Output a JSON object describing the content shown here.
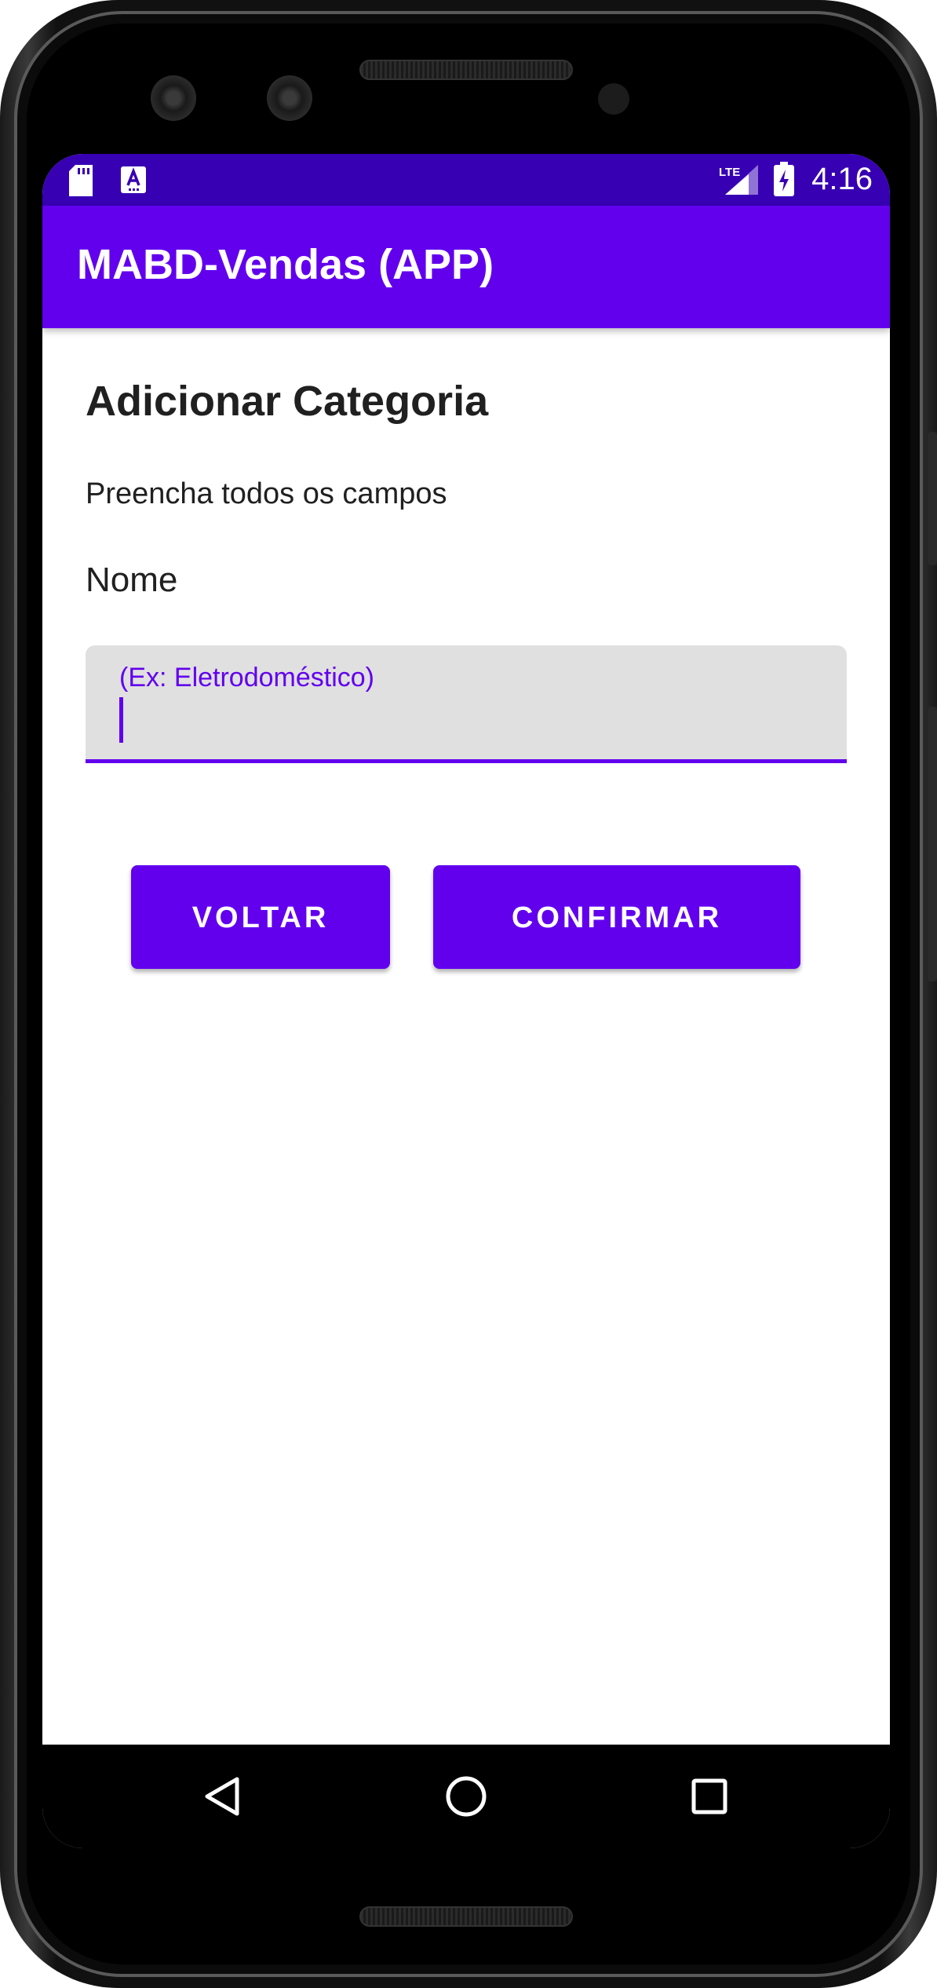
{
  "status_bar": {
    "time": "4:16",
    "network": "LTE",
    "icons": [
      "sd-card-icon",
      "keyboard-a-icon",
      "lte-signal-icon",
      "battery-charging-icon"
    ]
  },
  "app_bar": {
    "title": "MABD-Vendas (APP)",
    "color": "#6200ee"
  },
  "form": {
    "heading": "Adicionar Categoria",
    "subtitle": "Preencha todos os campos",
    "name_label": "Nome",
    "name_field": {
      "hint": "(Ex: Eletrodoméstico)",
      "value": ""
    }
  },
  "buttons": {
    "back_label": "VOLTAR",
    "confirm_label": "CONFIRMAR"
  },
  "nav_bar": {
    "icons": [
      "back-triangle-icon",
      "home-circle-icon",
      "recents-square-icon"
    ]
  },
  "colors": {
    "primary": "#6200ee",
    "primary_dark": "#3700b3",
    "field_bg": "#e0e0e0"
  }
}
